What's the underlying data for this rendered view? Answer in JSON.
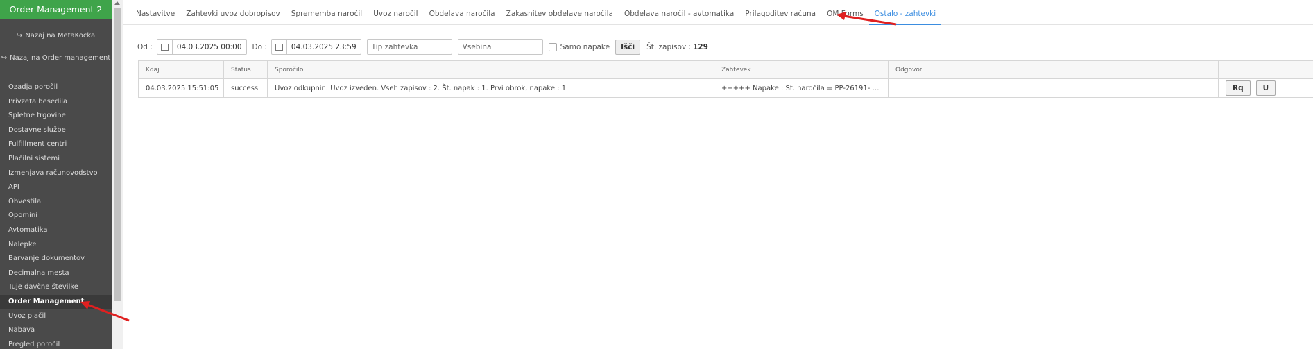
{
  "sidebar": {
    "title": "Order Management 2",
    "back_metakocka": "Nazaj na MetaKocka",
    "back_order_management": "Nazaj na Order management",
    "items": [
      {
        "label": "Ozadja poročil"
      },
      {
        "label": "Privzeta besedila"
      },
      {
        "label": "Spletne trgovine"
      },
      {
        "label": "Dostavne službe"
      },
      {
        "label": "Fulfillment centri"
      },
      {
        "label": "Plačilni sistemi"
      },
      {
        "label": "Izmenjava računovodstvo"
      },
      {
        "label": "API"
      },
      {
        "label": "Obvestila"
      },
      {
        "label": "Opomini"
      },
      {
        "label": "Avtomatika"
      },
      {
        "label": "Nalepke"
      },
      {
        "label": "Barvanje dokumentov"
      },
      {
        "label": "Decimalna mesta"
      },
      {
        "label": "Tuje davčne številke"
      },
      {
        "label": "Order Management"
      },
      {
        "label": "Uvoz plačil"
      },
      {
        "label": "Nabava"
      },
      {
        "label": "Pregled poročil"
      }
    ],
    "active_item": "Order Management"
  },
  "tabs": [
    {
      "label": "Nastavitve"
    },
    {
      "label": "Zahtevki uvoz dobropisov"
    },
    {
      "label": "Sprememba naročil"
    },
    {
      "label": "Uvoz naročil"
    },
    {
      "label": "Obdelava naročila"
    },
    {
      "label": "Zakasnitev obdelave naročila"
    },
    {
      "label": "Obdelava naročil - avtomatika"
    },
    {
      "label": "Prilagoditev računa"
    },
    {
      "label": "OM Forms"
    },
    {
      "label": "Ostalo - zahtevki"
    }
  ],
  "active_tab": "Ostalo - zahtevki",
  "filters": {
    "from_label": "Od :",
    "from_value": "04.03.2025 00:00",
    "to_label": "Do :",
    "to_value": "04.03.2025 23:59",
    "request_type_placeholder": "Tip zahtevka",
    "content_placeholder": "Vsebina",
    "errors_only_label": "Samo napake",
    "errors_only_checked": false,
    "search_label": "Išči",
    "count_label": "Št. zapisov :",
    "count_value": "129"
  },
  "table": {
    "headers": [
      "Kdaj",
      "Status",
      "Sporočilo",
      "Zahtevek",
      "Odgovor",
      ""
    ],
    "rows": [
      {
        "when": "04.03.2025 15:51:05",
        "status": "success",
        "message": "Uvoz odkupnin. Uvoz izveden. Vseh zapisov : 2. Št. napak : 1. Prvi obrok, napake : 1",
        "request": "+++++ Napake : Št. naročila = PP-26191- Nar...",
        "response": "",
        "btn_rq": "Rq",
        "btn_u": "U"
      }
    ]
  },
  "colors": {
    "sidebar_bg": "#4a4a4a",
    "sidebar_title_bg": "#3fa44a",
    "active_tab": "#3b8de0",
    "annotation_arrow": "#e02020"
  }
}
